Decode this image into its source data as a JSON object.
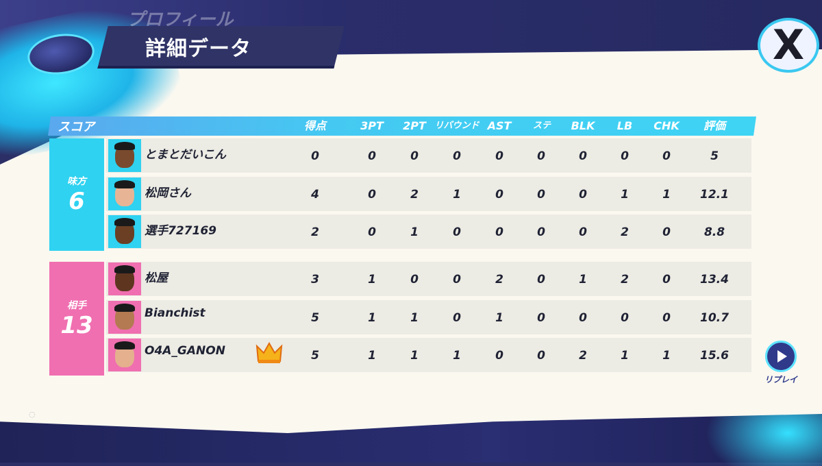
{
  "header": {
    "back_title": "プロフィール",
    "title": "詳細データ",
    "close_label": "X"
  },
  "table": {
    "section_label": "スコア",
    "columns": [
      "得点",
      "3PT",
      "2PT",
      "リバウンド",
      "AST",
      "ステ",
      "BLK",
      "LB",
      "CHK",
      "評価"
    ]
  },
  "teams": {
    "ally": {
      "label": "味方",
      "score": "6",
      "color": "#2fd2f0"
    },
    "opponent": {
      "label": "相手",
      "score": "13",
      "color": "#f06fb0"
    }
  },
  "players": [
    {
      "name": "とまとだいこん",
      "team": "ally",
      "stats": [
        "0",
        "0",
        "0",
        "0",
        "0",
        "0",
        "0",
        "0",
        "0",
        "5"
      ]
    },
    {
      "name": "松岡さん",
      "team": "ally",
      "stats": [
        "4",
        "0",
        "2",
        "1",
        "0",
        "0",
        "0",
        "1",
        "1",
        "12.1"
      ]
    },
    {
      "name": "選手727169",
      "team": "ally",
      "stats": [
        "2",
        "0",
        "1",
        "0",
        "0",
        "0",
        "0",
        "2",
        "0",
        "8.8"
      ]
    },
    {
      "name": "松屋",
      "team": "opponent",
      "stats": [
        "3",
        "1",
        "0",
        "0",
        "2",
        "0",
        "1",
        "2",
        "0",
        "13.4"
      ]
    },
    {
      "name": "Bianchist",
      "team": "opponent",
      "stats": [
        "5",
        "1",
        "1",
        "0",
        "1",
        "0",
        "0",
        "0",
        "0",
        "10.7"
      ]
    },
    {
      "name": "O4A_GANON",
      "team": "opponent",
      "stats": [
        "5",
        "1",
        "1",
        "1",
        "0",
        "0",
        "2",
        "1",
        "1",
        "15.6"
      ],
      "mvp": true
    }
  ],
  "replay_label": "リプレイ",
  "icons": {
    "close": "close-x-icon",
    "replay": "replay-play-icon",
    "mvp": "crown-icon",
    "ball": "basketball-icon"
  }
}
